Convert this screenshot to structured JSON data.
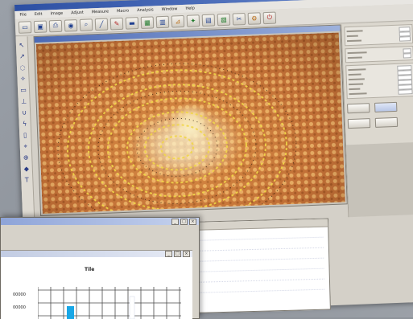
{
  "menu": [
    "File",
    "Edit",
    "Image",
    "Adjust",
    "Measure",
    "Macro",
    "Analysis",
    "Window",
    "Help"
  ],
  "toolbar_icons": [
    "new-icon",
    "save-icon",
    "print-icon",
    "camera-icon",
    "zoom-icon",
    "line-icon",
    "pen-icon",
    "rect-icon",
    "grid-icon",
    "histogram-icon",
    "measure-icon",
    "palette-icon",
    "layers-icon",
    "filter-icon",
    "crop-icon",
    "settings-icon",
    "exit-icon"
  ],
  "side_tools": [
    "pointer-icon",
    "arrow-icon",
    "lasso-icon",
    "wand-icon",
    "ruler-icon",
    "eyedropper-icon",
    "magnet-icon",
    "brush-icon",
    "eraser-icon",
    "pin-icon",
    "stamp-icon",
    "fill-icon",
    "text-icon"
  ],
  "chart_window": {
    "title": "Tile",
    "y_ticks": [
      "00000",
      "00000"
    ]
  },
  "chart_data": {
    "type": "bar",
    "title": "Tile",
    "categories": [],
    "values": []
  },
  "colors": {
    "accent": "#2c4fa3",
    "honey": "#c9753a",
    "ring": "#f1d74a",
    "bar": "#19a7e6"
  }
}
